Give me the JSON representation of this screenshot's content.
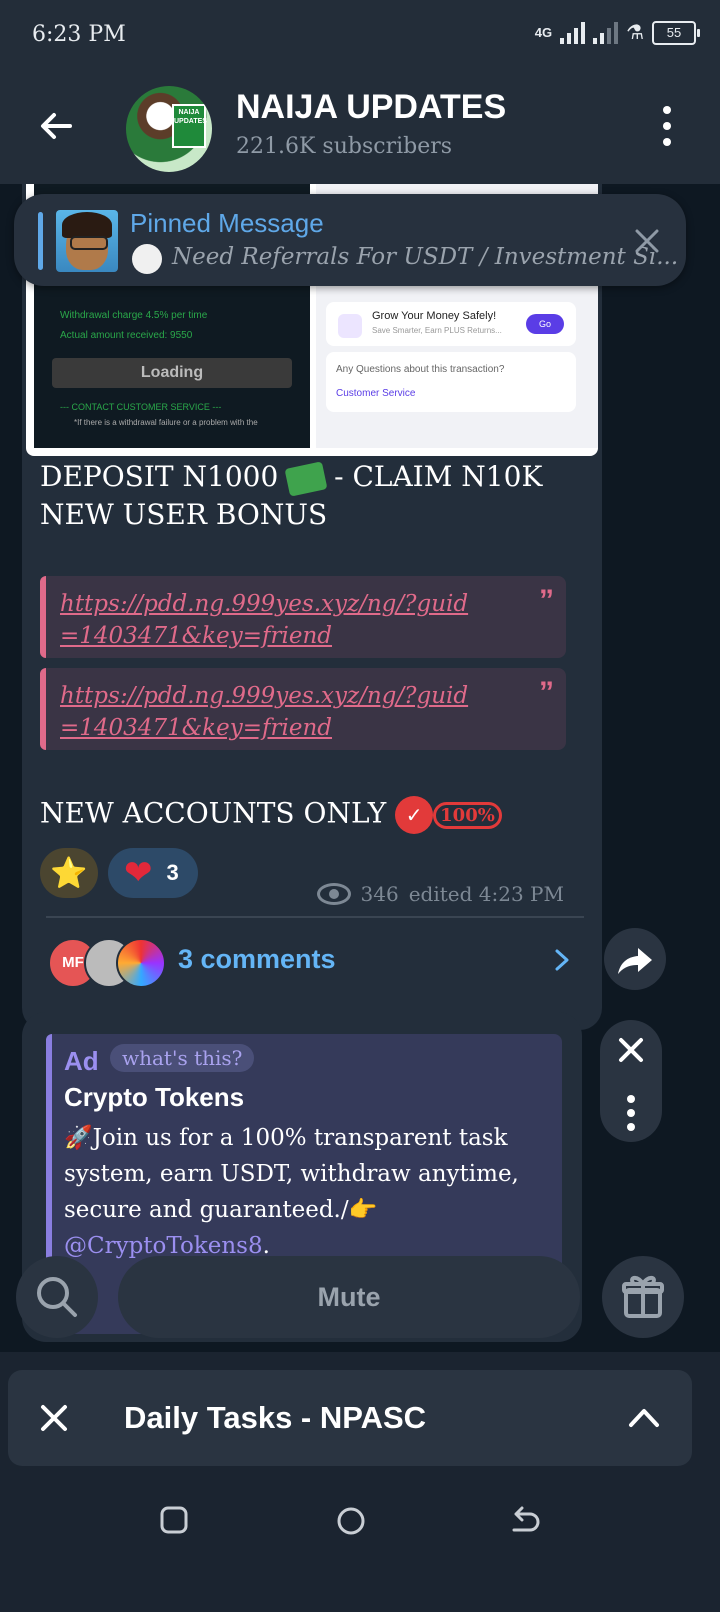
{
  "status": {
    "time": "6:23 PM",
    "network": "4G",
    "battery": "55"
  },
  "channel": {
    "title": "NAIJA UPDATES",
    "subscribers": "221.6K subscribers",
    "avatar_text": "NAIJA UPDATES"
  },
  "pinned": {
    "title": "Pinned Message",
    "text": "Need Referrals For USDT / Investment Si..."
  },
  "post_image": {
    "withdrawal_charge": "Withdrawal charge 4.5% per time",
    "actual_received": "Actual amount received: 9550",
    "loading": "Loading",
    "contact": "--- CONTACT CUSTOMER SERVICE ---",
    "failure_note": "*If there is a withdrawal failure or a problem with the",
    "grow_title": "Grow Your Money Safely!",
    "grow_sub": "Save Smarter, Earn PLUS Returns...",
    "go": "Go",
    "questions": "Any Questions about this transaction?",
    "customer_service": "Customer Service"
  },
  "post": {
    "text": "DEPOSIT N1000",
    "text2": "- CLAIM N10K NEW USER BONUS",
    "links": [
      "https://pdd.ng.999yes.xyz/ng/?guid=1403471&key=friend",
      "https://pdd.ng.999yes.xyz/ng/?guid=1403471&key=friend"
    ],
    "new_accounts": "NEW ACCOUNTS ONLY",
    "badge": "100%",
    "reactions": [
      {
        "emoji": "⭐",
        "count": ""
      },
      {
        "emoji": "❤",
        "count": "3"
      }
    ],
    "views": "346",
    "edited": "edited 4:23 PM",
    "comments": "3 comments",
    "commenter_initials": "MF"
  },
  "ad": {
    "label": "Ad",
    "whats_this": "what's this?",
    "title": "Crypto Tokens",
    "text": "Join us for a 100% transparent task system, earn USDT, withdraw anytime, secure and guaranteed./",
    "handle": "@CryptoTokens8",
    "end": "."
  },
  "bottom": {
    "mute": "Mute",
    "tasks_label": "Daily Tasks - NPASC"
  },
  "colors": {
    "accent": "#64b5f6",
    "quote": "#e06a8a",
    "ad": "#9b8ff0",
    "bg": "#1b2430"
  }
}
